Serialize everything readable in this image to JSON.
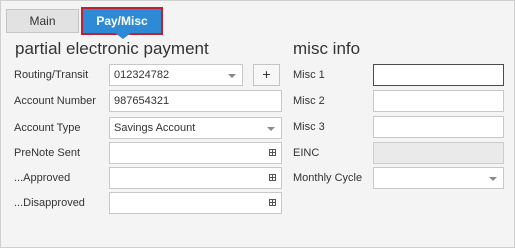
{
  "tabs": {
    "main": "Main",
    "pay_misc": "Pay/Misc"
  },
  "pep": {
    "title": "partial electronic payment",
    "routing_label": "Routing/Transit",
    "routing_value": "012324782",
    "add_button": "+",
    "account_number_label": "Account Number",
    "account_number_value": "987654321",
    "account_type_label": "Account Type",
    "account_type_value": "Savings Account",
    "prenote_label": "PreNote Sent",
    "prenote_value": "",
    "approved_label": "...Approved",
    "approved_value": "",
    "disapproved_label": "...Disapproved",
    "disapproved_value": ""
  },
  "misc": {
    "title": "misc info",
    "misc1_label": "Misc 1",
    "misc1_value": "",
    "misc2_label": "Misc 2",
    "misc2_value": "",
    "misc3_label": "Misc 3",
    "misc3_value": "",
    "einc_label": "EINC",
    "einc_value": "",
    "monthly_cycle_label": "Monthly Cycle",
    "monthly_cycle_value": ""
  },
  "icons": {
    "dropdown": "chevron-down-icon",
    "date": "calendar-icon",
    "add": "plus-icon"
  },
  "colors": {
    "active_tab": "#2f8ad5",
    "active_tab_outline": "#c0212e",
    "panel_bg": "#f4f4f4"
  }
}
